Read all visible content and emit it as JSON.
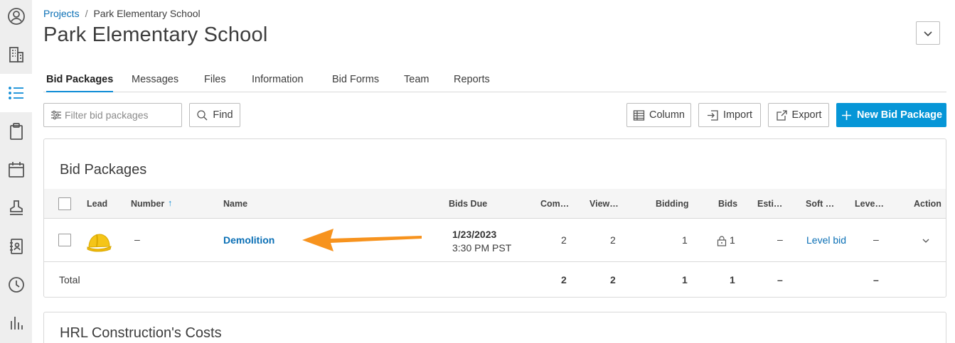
{
  "breadcrumb": {
    "projects": "Projects",
    "separator": "/",
    "current": "Park Elementary School"
  },
  "page": {
    "title": "Park Elementary School"
  },
  "tabs": [
    {
      "label": "Bid Packages"
    },
    {
      "label": "Messages"
    },
    {
      "label": "Files"
    },
    {
      "label": "Information"
    },
    {
      "label": "Bid Forms"
    },
    {
      "label": "Team"
    },
    {
      "label": "Reports"
    }
  ],
  "toolbar": {
    "filter_placeholder": "Filter bid packages",
    "find": "Find",
    "column": "Column",
    "import": "Import",
    "export": "Export",
    "new_bid_package": "New Bid Package"
  },
  "bid_packages": {
    "title": "Bid Packages",
    "columns": {
      "lead": "Lead",
      "number": "Number",
      "name": "Name",
      "bids_due": "Bids Due",
      "committed": "Com…",
      "viewed": "View…",
      "bidding": "Bidding",
      "bids": "Bids",
      "estimate": "Esti…",
      "soft": "Soft …",
      "level": "Leve…",
      "action": "Action"
    },
    "rows": [
      {
        "number": "–",
        "name": "Demolition",
        "due_date": "1/23/2023",
        "due_time": "3:30 PM PST",
        "committed": "2",
        "viewed": "2",
        "bidding": "1",
        "bids": "1",
        "estimate": "–",
        "soft": "Level bid",
        "level": "–"
      }
    ],
    "total": {
      "label": "Total",
      "committed": "2",
      "viewed": "2",
      "bidding": "1",
      "bids": "1",
      "estimate": "–",
      "level": "–"
    }
  },
  "costs_panel": {
    "title": "HRL Construction's Costs"
  },
  "colors": {
    "accent": "#0696d7",
    "link": "#0a6fb5",
    "arrow": "#f7931e",
    "helmet": "#f5c518"
  }
}
